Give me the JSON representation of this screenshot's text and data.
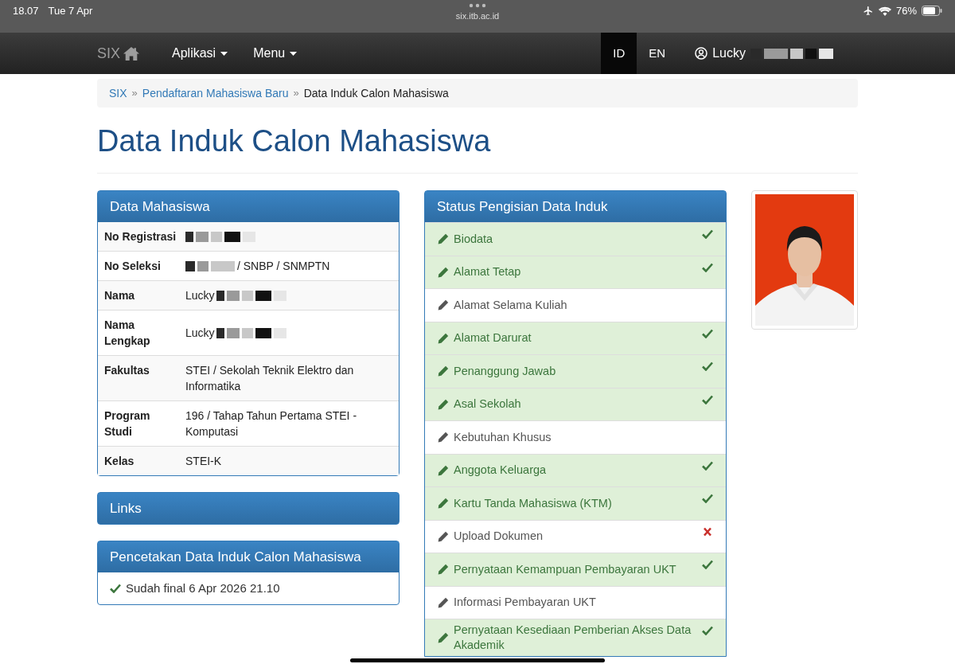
{
  "status_bar": {
    "time": "18.07",
    "date": "Tue 7 Apr",
    "url": "six.itb.ac.id",
    "battery": "76%"
  },
  "navbar": {
    "brand": "SIX",
    "menus": [
      "Aplikasi",
      "Menu"
    ],
    "languages": [
      {
        "label": "ID",
        "selected": true
      },
      {
        "label": "EN",
        "selected": false
      }
    ],
    "user": {
      "name": "Lucky",
      "redacted": true
    }
  },
  "breadcrumb": {
    "separator": "»",
    "items": [
      {
        "label": "SIX",
        "link": true
      },
      {
        "label": "Pendaftaran Mahasiswa Baru",
        "link": true
      },
      {
        "label": "Data Induk Calon Mahasiswa",
        "link": false
      }
    ]
  },
  "title": "Data Induk Calon Mahasiswa",
  "data_mahasiswa": {
    "heading": "Data Mahasiswa",
    "rows": [
      {
        "label": "No Registrasi",
        "value": "",
        "redacted": true
      },
      {
        "label": "No Seleksi",
        "value": "/ SNBP / SNMPTN",
        "redacted": true,
        "redact_first": true
      },
      {
        "label": "Nama",
        "value": "Lucky",
        "redacted": true
      },
      {
        "label": "Nama Lengkap",
        "value": "Lucky",
        "redacted": true
      },
      {
        "label": "Fakultas",
        "value": "STEI / Sekolah Teknik Elektro dan Informatika",
        "redacted": false
      },
      {
        "label": "Program Studi",
        "value": "196 / Tahap Tahun Pertama STEI - Komputasi",
        "redacted": false
      },
      {
        "label": "Kelas",
        "value": "STEI-K",
        "redacted": false
      }
    ]
  },
  "links": {
    "heading": "Links"
  },
  "pencetakan": {
    "heading": "Pencetakan Data Induk Calon Mahasiswa",
    "status": "Sudah final 6 Apr 2026 21.10"
  },
  "status_pengisian": {
    "heading": "Status Pengisian Data Induk",
    "items": [
      {
        "label": "Biodata",
        "complete": true,
        "failed": false
      },
      {
        "label": "Alamat Tetap",
        "complete": true,
        "failed": false
      },
      {
        "label": "Alamat Selama Kuliah",
        "complete": false,
        "failed": false
      },
      {
        "label": "Alamat Darurat",
        "complete": true,
        "failed": false
      },
      {
        "label": "Penanggung Jawab",
        "complete": true,
        "failed": false
      },
      {
        "label": "Asal Sekolah",
        "complete": true,
        "failed": false
      },
      {
        "label": "Kebutuhan Khusus",
        "complete": false,
        "failed": false
      },
      {
        "label": "Anggota Keluarga",
        "complete": true,
        "failed": false
      },
      {
        "label": "Kartu Tanda Mahasiswa (KTM)",
        "complete": true,
        "failed": false
      },
      {
        "label": "Upload Dokumen",
        "complete": false,
        "failed": true
      },
      {
        "label": "Pernyataan Kemampuan Pembayaran UKT",
        "complete": true,
        "failed": false
      },
      {
        "label": "Informasi Pembayaran UKT",
        "complete": false,
        "failed": false
      },
      {
        "label": "Pernyataan Kesediaan Pemberian Akses Data Akademik",
        "complete": true,
        "failed": false
      }
    ]
  }
}
